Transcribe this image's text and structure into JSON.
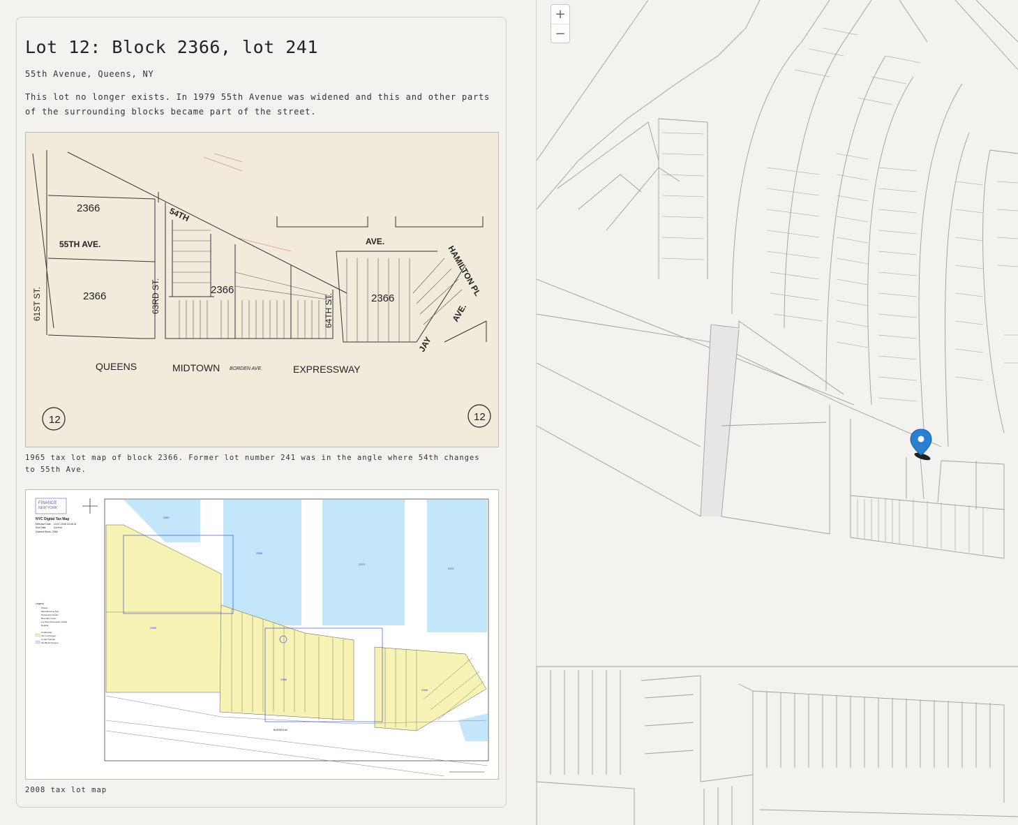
{
  "lot": {
    "title": "Lot 12: Block 2366, lot 241",
    "address": "55th Avenue, Queens, NY",
    "description": "This lot no longer exists. In 1979 55th Avenue was widened and this and other parts of the surrounding blocks became part of the street."
  },
  "figures": [
    {
      "caption": "1965 tax lot map of block 2366. Former lot number 241 was in the angle where 54th changes to 55th Ave.",
      "labels": {
        "block_a": "2366",
        "block_b": "2366",
        "block_c": "2366",
        "block_d": "2366",
        "st_61": "61ST ST.",
        "ave_55": "55TH AVE.",
        "st_63": "63RD ST.",
        "st_54": "54TH",
        "ave": "AVE.",
        "st_64": "64TH ST.",
        "hamilton": "HAMILTON PL",
        "jay": "JAY",
        "jay_ave": "AVE.",
        "queens": "QUEENS",
        "midtown": "MIDTOWN",
        "borden": "BORDEN AVE.",
        "expressway": "EXPRESSWAY",
        "plate_left": "12",
        "plate_right": "12"
      }
    },
    {
      "caption": "2008 tax lot map",
      "labels": {
        "agency_line1": "FINANCE",
        "agency_line2": "NEW YORK",
        "map_title": "NYC Digital Tax Map",
        "effective_date_label": "Effective Date",
        "effective_date": "13-07-2008 23:46:31",
        "end_date_label": "End Date",
        "end_date": "Current",
        "block_line": "Queens Block: 2366",
        "legend_title": "Legend",
        "legend_items": [
          "Streets",
          "Miscellaneous Text",
          "Possession Hooks",
          "Boundary Lines",
          "Lot Face Possession Hooks",
          "Regular",
          "Underwater",
          "Tax Lot Polygon",
          "Condo Number",
          "Tax Block Polygon"
        ],
        "block_numbers": [
          "2367",
          "2369",
          "2370",
          "2371",
          "2365",
          "2366",
          "2366"
        ],
        "borden": "BORDEN AV"
      }
    }
  ],
  "map": {
    "zoom_in": "+",
    "zoom_out": "−",
    "marker_icon": "map-pin-icon",
    "marker_color": "#2a7fd1"
  },
  "colors": {
    "background": "#f3f2ee",
    "map_lines": "#9d9b96",
    "water": "#c3e6fb",
    "lot_yellow": "#f6f3b4",
    "scan_paper": "#f2ebdc"
  }
}
